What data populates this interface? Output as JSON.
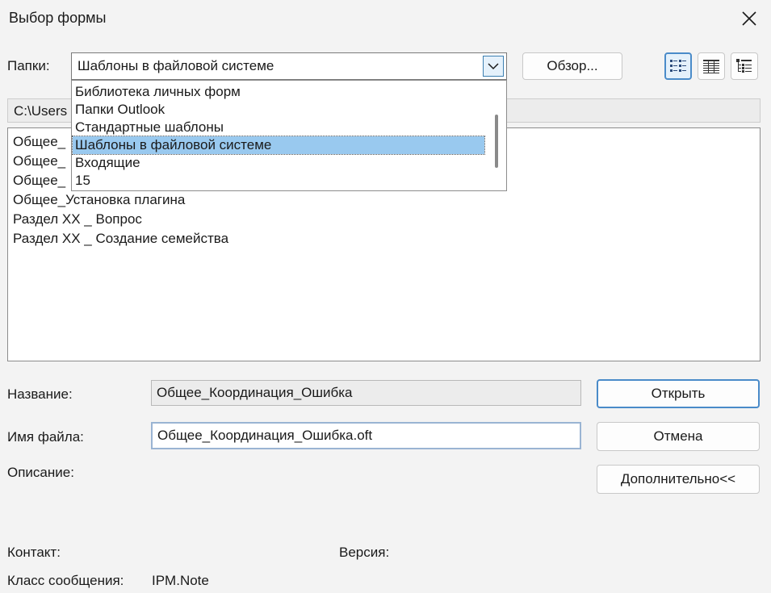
{
  "window": {
    "title": "Выбор формы"
  },
  "folders": {
    "label": "Папки:",
    "selected": "Шаблоны в файловой системе",
    "browse_label": "Обзор...",
    "options": [
      "Библиотека личных форм",
      "Папки Outlook",
      "Стандартные шаблоны",
      "Шаблоны в файловой системе",
      "Входящие",
      "15"
    ],
    "selected_index": 3
  },
  "view_buttons": [
    "list-view-icon",
    "details-view-icon",
    "tree-view-icon"
  ],
  "path": {
    "value": "C:\\Users"
  },
  "list": {
    "items": [
      "Общее_",
      "Общее_",
      "Общее_",
      "Общее_Установка плагина",
      "Раздел XX _ Вопрос",
      "Раздел XX _ Создание семейства"
    ]
  },
  "form": {
    "name_label": "Название:",
    "name_value": "Общее_Координация_Ошибка",
    "filename_label": "Имя файла:",
    "filename_value": "Общее_Координация_Ошибка.oft",
    "description_label": "Описание:",
    "contact_label": "Контакт:",
    "version_label": "Версия:",
    "message_class_label": "Класс сообщения:",
    "message_class_value": "IPM.Note"
  },
  "buttons": {
    "open": "Открыть",
    "cancel": "Отмена",
    "advanced": "Дополнительно<<"
  },
  "colors": {
    "accent": "#4a8bc9",
    "selection": "#99c9ef",
    "background": "#f3f3f3"
  }
}
